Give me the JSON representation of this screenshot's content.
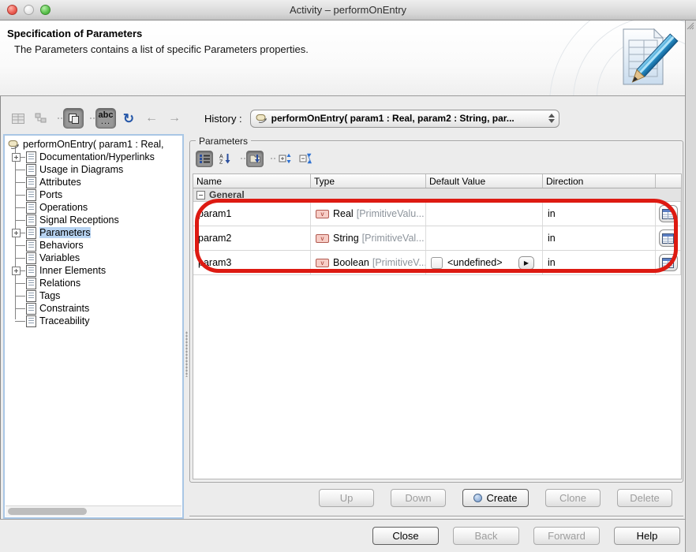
{
  "window": {
    "title": "Activity – performOnEntry"
  },
  "header": {
    "title": "Specification of Parameters",
    "description": "The Parameters contains a list of specific Parameters properties."
  },
  "toolbar": {
    "history_label": "History :",
    "history_value": "performOnEntry( param1 : Real, param2 : String, par...",
    "abc_label": "abc",
    "abc_dots": "...",
    "refresh_glyph": "↻",
    "back_glyph": "←",
    "forward_glyph": "→"
  },
  "tree": {
    "root": "performOnEntry( param1 : Real,",
    "items": [
      {
        "label": "Documentation/Hyperlinks",
        "expandable": true
      },
      {
        "label": "Usage in Diagrams"
      },
      {
        "label": "Attributes"
      },
      {
        "label": "Ports"
      },
      {
        "label": "Operations"
      },
      {
        "label": "Signal Receptions"
      },
      {
        "label": "Parameters",
        "expandable": true,
        "selected": true
      },
      {
        "label": "Behaviors"
      },
      {
        "label": "Variables"
      },
      {
        "label": "Inner Elements",
        "expandable": true
      },
      {
        "label": "Relations"
      },
      {
        "label": "Tags"
      },
      {
        "label": "Constraints"
      },
      {
        "label": "Traceability"
      }
    ]
  },
  "params": {
    "title": "Parameters",
    "columns": [
      "Name",
      "Type",
      "Default Value",
      "Direction"
    ],
    "group_label": "General",
    "valuetype_glyph": "v",
    "rows": [
      {
        "name": "param1",
        "type": "Real",
        "type_rest": "[PrimitiveValu...",
        "default": "",
        "direction": "in"
      },
      {
        "name": "param2",
        "type": "String",
        "type_rest": "[PrimitiveVal...",
        "default": "",
        "direction": "in"
      },
      {
        "name": "param3",
        "type": "Boolean",
        "type_rest": "[PrimitiveV...",
        "default": "<undefined>",
        "direction": "in",
        "expand_glyph": "▶"
      }
    ],
    "buttons": [
      {
        "label": "Up",
        "enabled": false
      },
      {
        "label": "Down",
        "enabled": false
      },
      {
        "label": "Create",
        "enabled": true
      },
      {
        "label": "Clone",
        "enabled": false
      },
      {
        "label": "Delete",
        "enabled": false
      }
    ]
  },
  "dialog_buttons": [
    {
      "label": "Close",
      "enabled": true
    },
    {
      "label": "Back",
      "enabled": false
    },
    {
      "label": "Forward",
      "enabled": false
    },
    {
      "label": "Help",
      "enabled": true
    }
  ],
  "colors": {
    "selection_blue": "#b7d3f1",
    "annotation_red": "#dd1a12",
    "refresh_blue": "#2456a8",
    "valuetype_pink": "#f7cdc6",
    "tree_focus_border": "#a9c6e5"
  }
}
